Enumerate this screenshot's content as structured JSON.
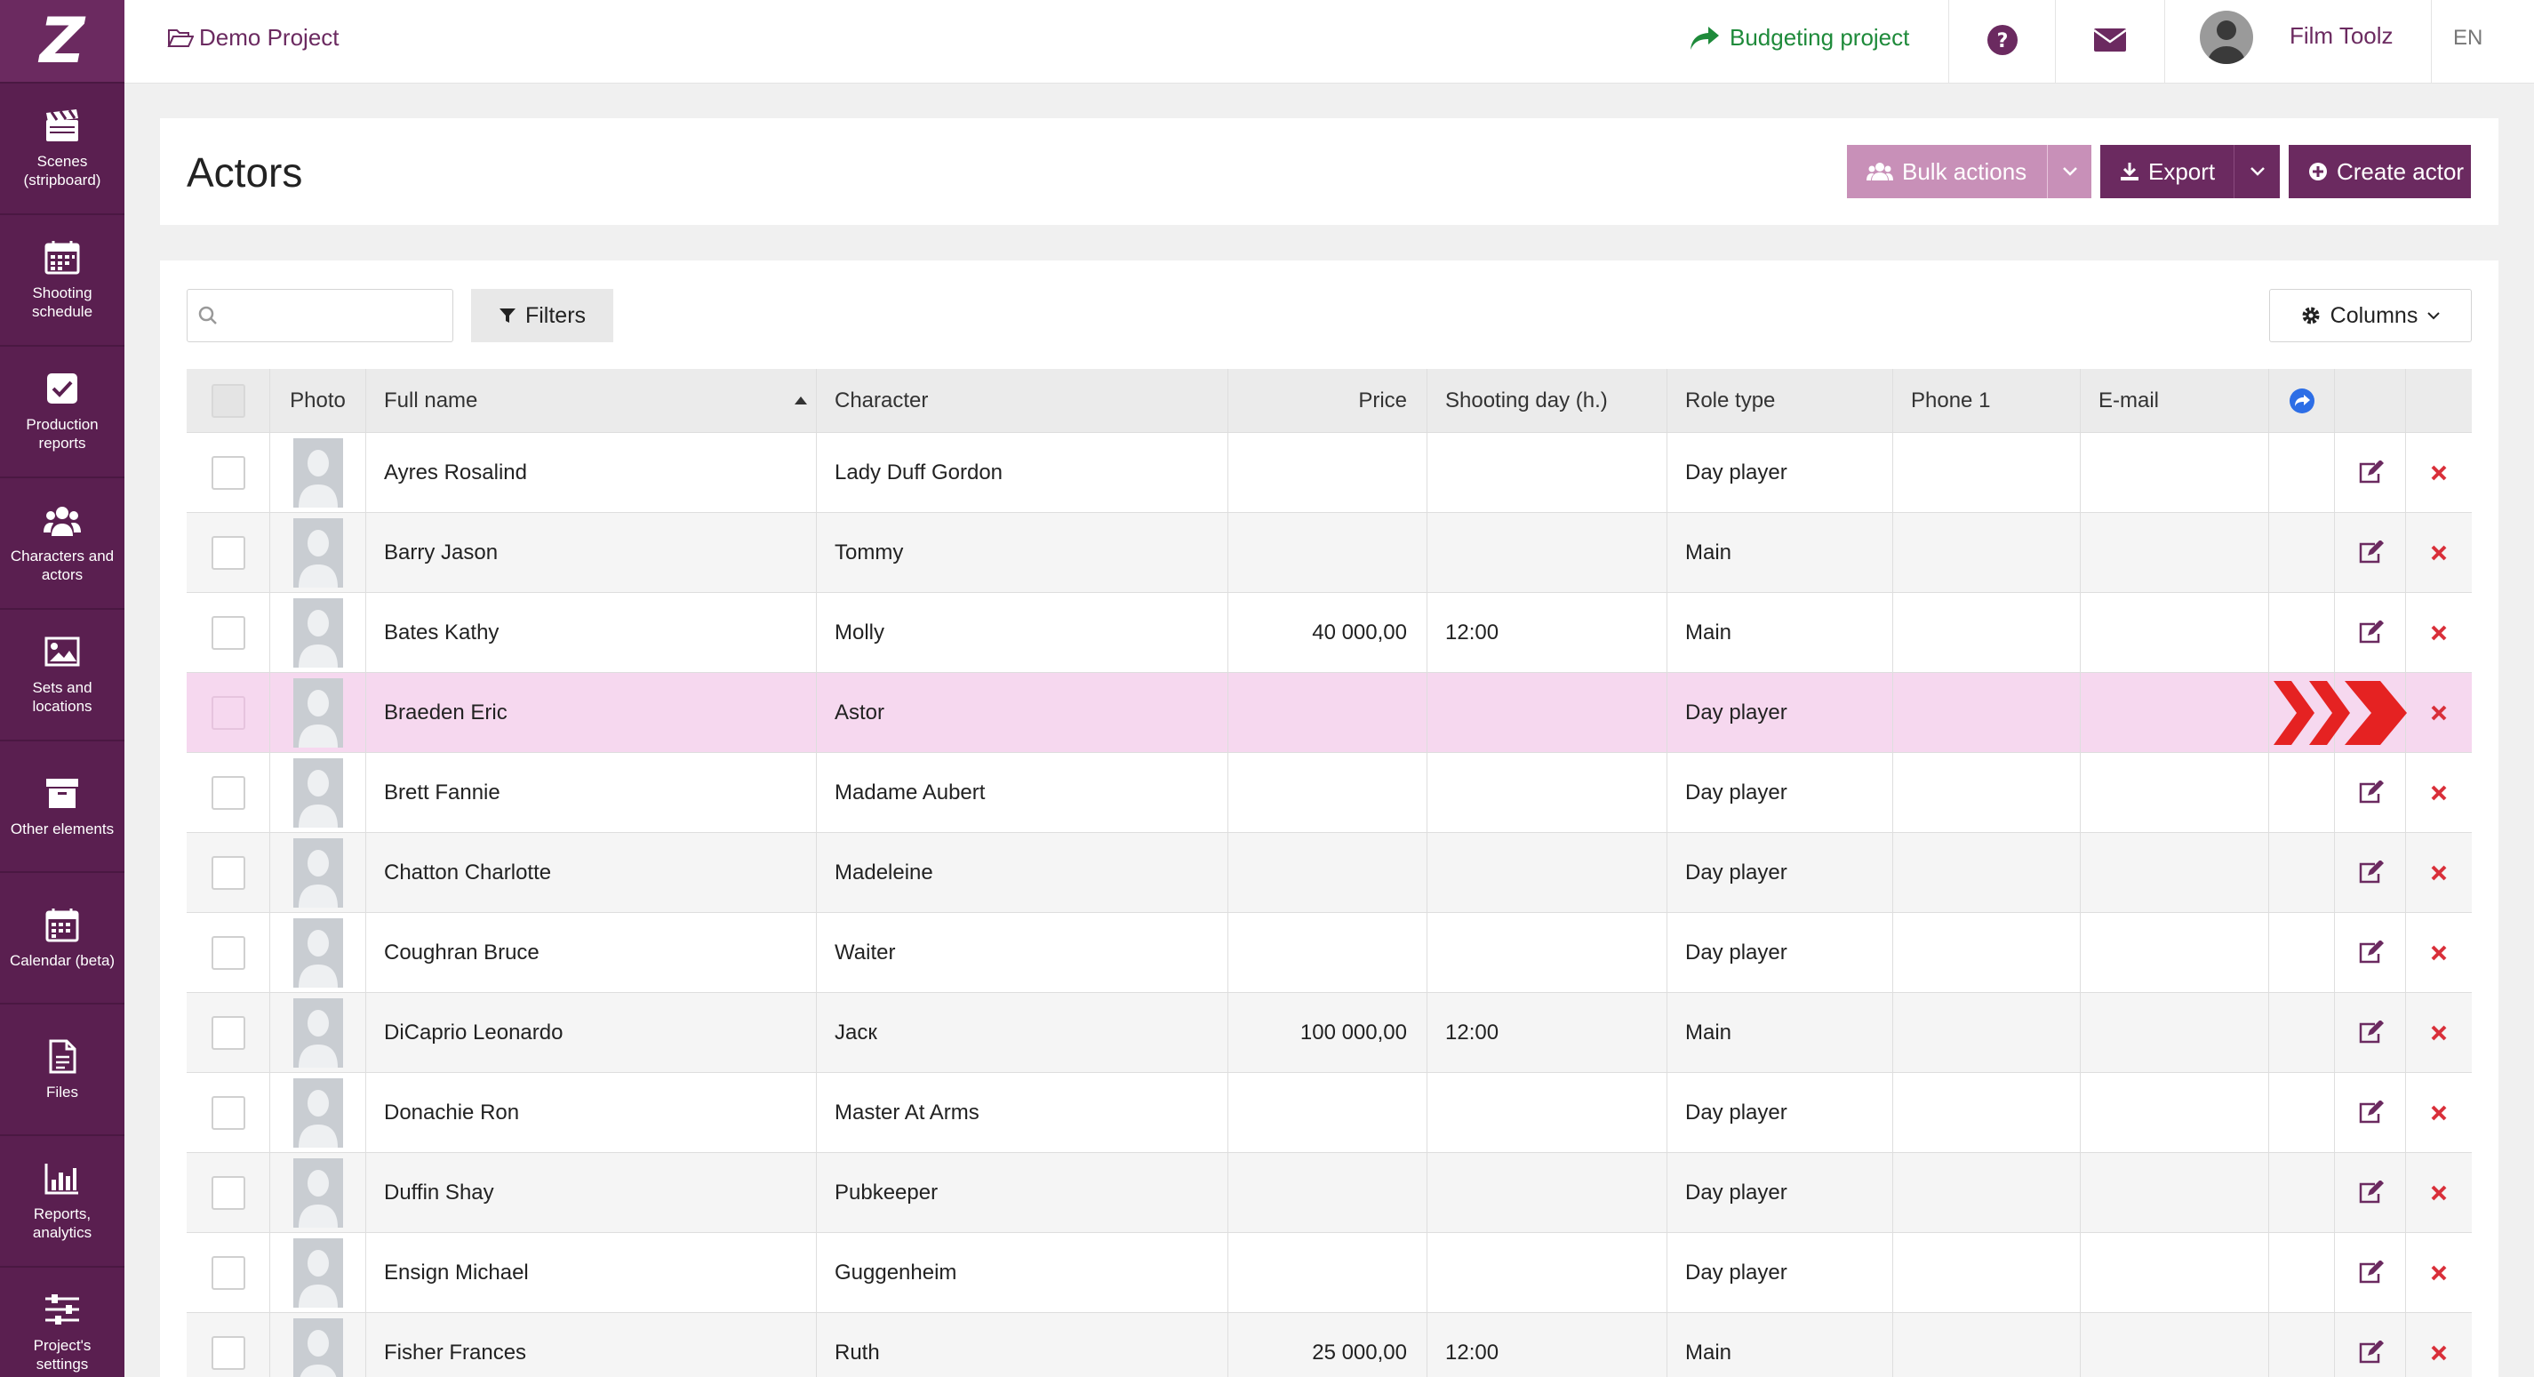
{
  "app": {
    "logo_letter": "Z",
    "project_name": "Demo Project",
    "budgeting_label": "Budgeting project",
    "user_name": "Film Toolz",
    "language": "EN"
  },
  "sidebar": {
    "items": [
      {
        "line1": "Scenes",
        "line2": "(stripboard)",
        "icon": "clapperboard-icon"
      },
      {
        "line1": "Shooting",
        "line2": "schedule",
        "icon": "calendar-grid-icon"
      },
      {
        "line1": "Production",
        "line2": "reports",
        "icon": "check-square-icon"
      },
      {
        "line1": "Characters and",
        "line2": "actors",
        "icon": "users-icon"
      },
      {
        "line1": "Sets and",
        "line2": "locations",
        "icon": "image-icon"
      },
      {
        "line1": "Other elements",
        "line2": "",
        "icon": "archive-box-icon"
      },
      {
        "line1": "Calendar (beta)",
        "line2": "",
        "icon": "calendar-icon"
      },
      {
        "line1": "Files",
        "line2": "",
        "icon": "file-icon"
      },
      {
        "line1": "Reports,",
        "line2": "analytics",
        "icon": "bar-chart-icon"
      },
      {
        "line1": "Project's",
        "line2": "settings",
        "icon": "sliders-icon"
      }
    ]
  },
  "header": {
    "title": "Actors",
    "bulk_actions": "Bulk actions",
    "export": "Export",
    "create_actor": "Create actor"
  },
  "toolbar": {
    "search_placeholder": "",
    "filters": "Filters",
    "columns": "Columns"
  },
  "table": {
    "columns": [
      "Photo",
      "Full name",
      "Character",
      "Price",
      "Shooting day (h.)",
      "Role type",
      "Phone 1",
      "E-mail"
    ],
    "rows": [
      {
        "name": "Ayres Rosalind",
        "character": "Lady Duff Gordon",
        "price": "",
        "day": "",
        "role": "Day player"
      },
      {
        "name": "Barry Jason",
        "character": "Tommy",
        "price": "",
        "day": "",
        "role": "Main"
      },
      {
        "name": "Bates Kathy",
        "character": "Molly",
        "price": "40 000,00",
        "day": "12:00",
        "role": "Main"
      },
      {
        "name": "Braeden Eric",
        "character": "Astor",
        "price": "",
        "day": "",
        "role": "Day player"
      },
      {
        "name": "Brett Fannie",
        "character": "Madame Aubert",
        "price": "",
        "day": "",
        "role": "Day player"
      },
      {
        "name": "Chatton Charlotte",
        "character": "Madeleine",
        "price": "",
        "day": "",
        "role": "Day player"
      },
      {
        "name": "Coughran Bruce",
        "character": "Waiter",
        "price": "",
        "day": "",
        "role": "Day player"
      },
      {
        "name": "DiCaprio Leonardo",
        "character": "Jacк",
        "price": "100 000,00",
        "day": "12:00",
        "role": "Main"
      },
      {
        "name": "Donachie Ron",
        "character": "Master At Arms",
        "price": "",
        "day": "",
        "role": "Day player"
      },
      {
        "name": "Duffin Shay",
        "character": "Pubkeeper",
        "price": "",
        "day": "",
        "role": "Day player"
      },
      {
        "name": "Ensign Michael",
        "character": "Guggenheim",
        "price": "",
        "day": "",
        "role": "Day player"
      },
      {
        "name": "Fisher Frances",
        "character": "Ruth",
        "price": "25 000,00",
        "day": "12:00",
        "role": "Main"
      }
    ]
  },
  "colors": {
    "brand": "#6b2a60",
    "sidebar": "#5a1f50",
    "bulk": "#c890b8",
    "highlight_row": "#f6d8ef",
    "delete": "#d9303a",
    "budget_link": "#1e8a3a",
    "share": "#2d6ee6",
    "arrow_annotation": "#e52222"
  }
}
